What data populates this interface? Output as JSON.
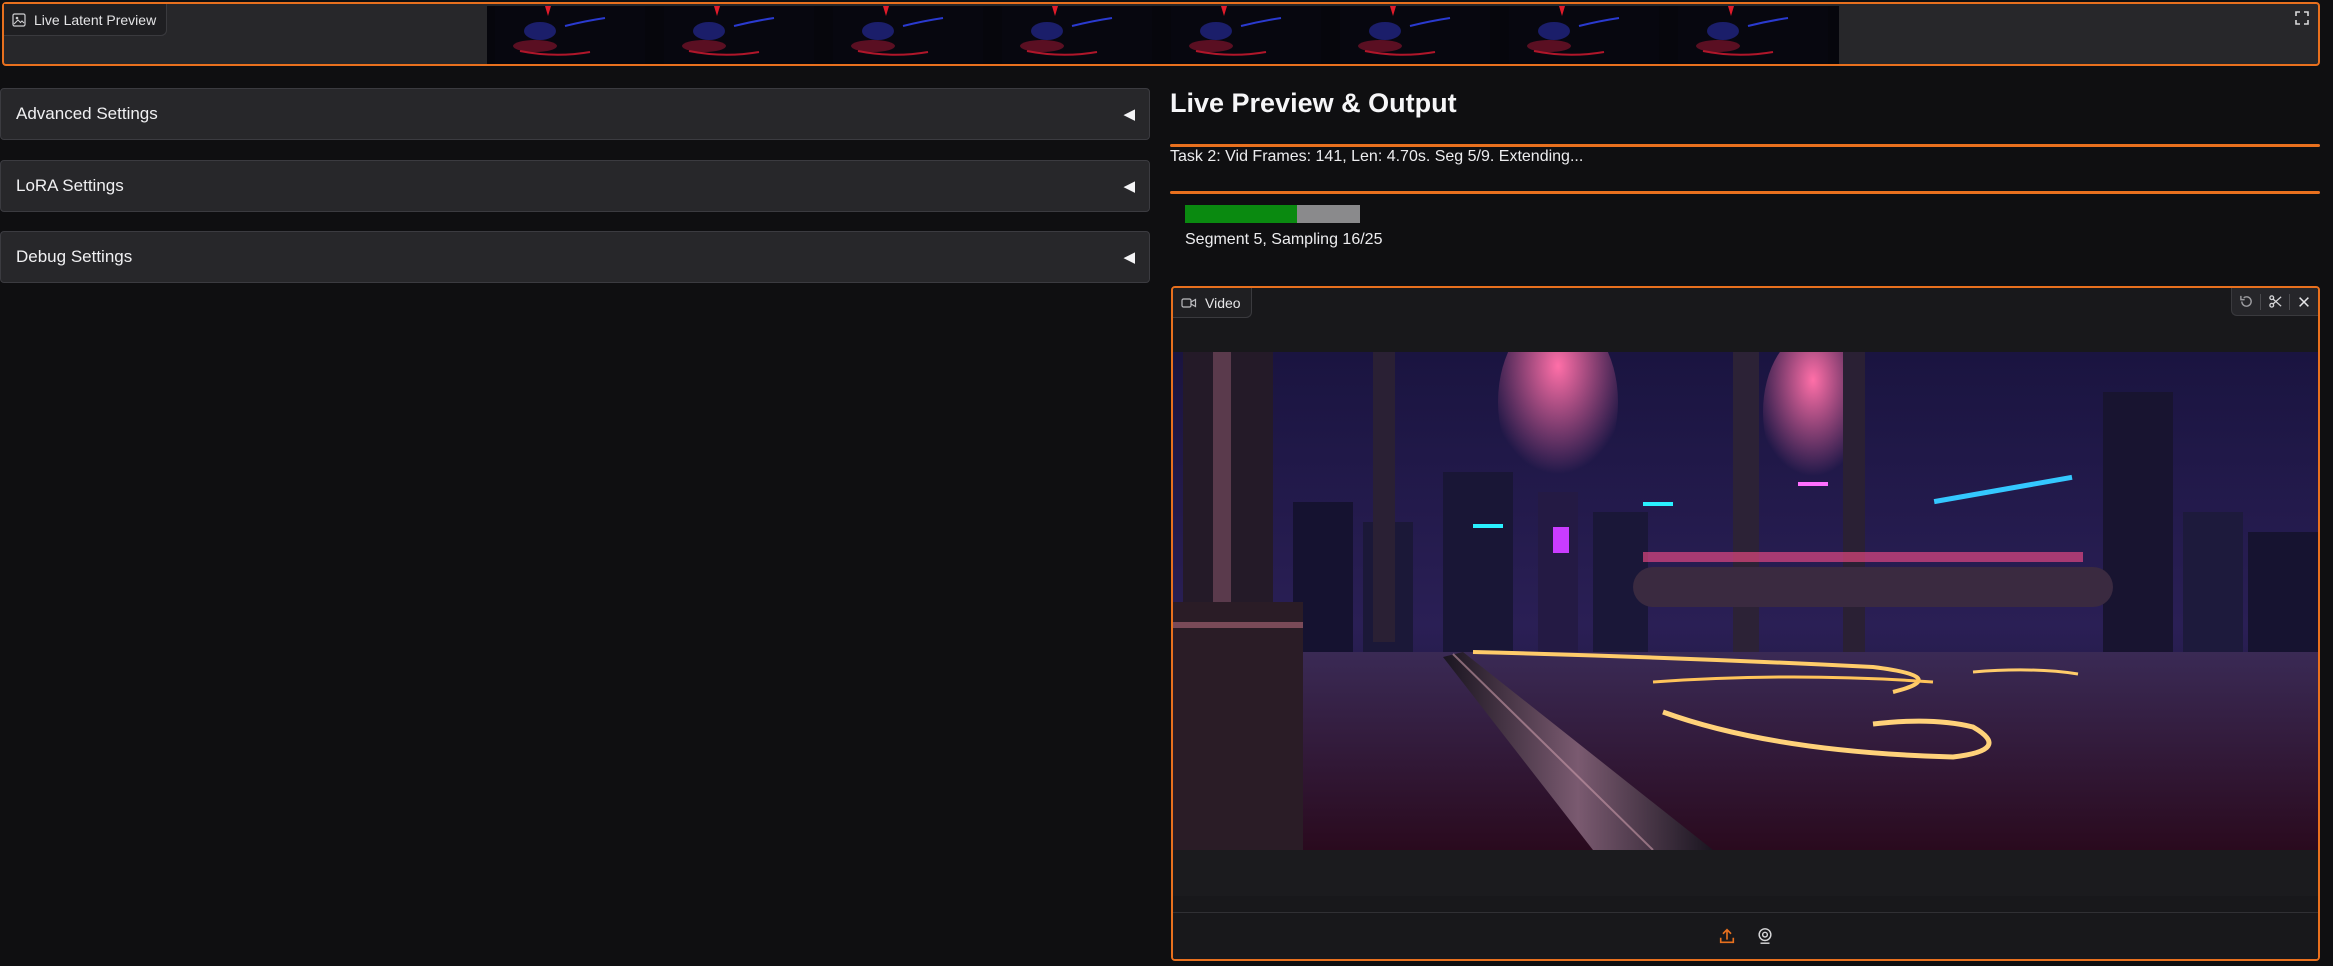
{
  "latent_preview": {
    "label": "Live Latent Preview",
    "label_icon": "image-icon",
    "fullscreen_icon": "fullscreen-icon",
    "frame_count": 8
  },
  "left_panel": {
    "accordions": [
      {
        "label": "Advanced Settings",
        "arrow": "◀"
      },
      {
        "label": "LoRA Settings",
        "arrow": "◀"
      },
      {
        "label": "Debug Settings",
        "arrow": "◀"
      }
    ]
  },
  "right_panel": {
    "title": "Live Preview & Output",
    "task_status": "Task 2: Vid Frames: 141, Len: 4.70s. Seg 5/9. Extending...",
    "progress": {
      "fraction": 0.64,
      "text": "Segment 5, Sampling 16/25"
    },
    "video": {
      "tab_label": "Video",
      "tab_icon": "video-camera-icon",
      "tools": [
        "undo-icon",
        "scissors-icon",
        "close-icon"
      ],
      "footer_icons": [
        "upload-icon",
        "webcam-icon"
      ]
    }
  },
  "colors": {
    "accent": "#e8701e",
    "background": "#0f0f11",
    "panel": "#27272a",
    "progress_fill": "#0a8a10",
    "progress_track": "#8a8a8c"
  }
}
